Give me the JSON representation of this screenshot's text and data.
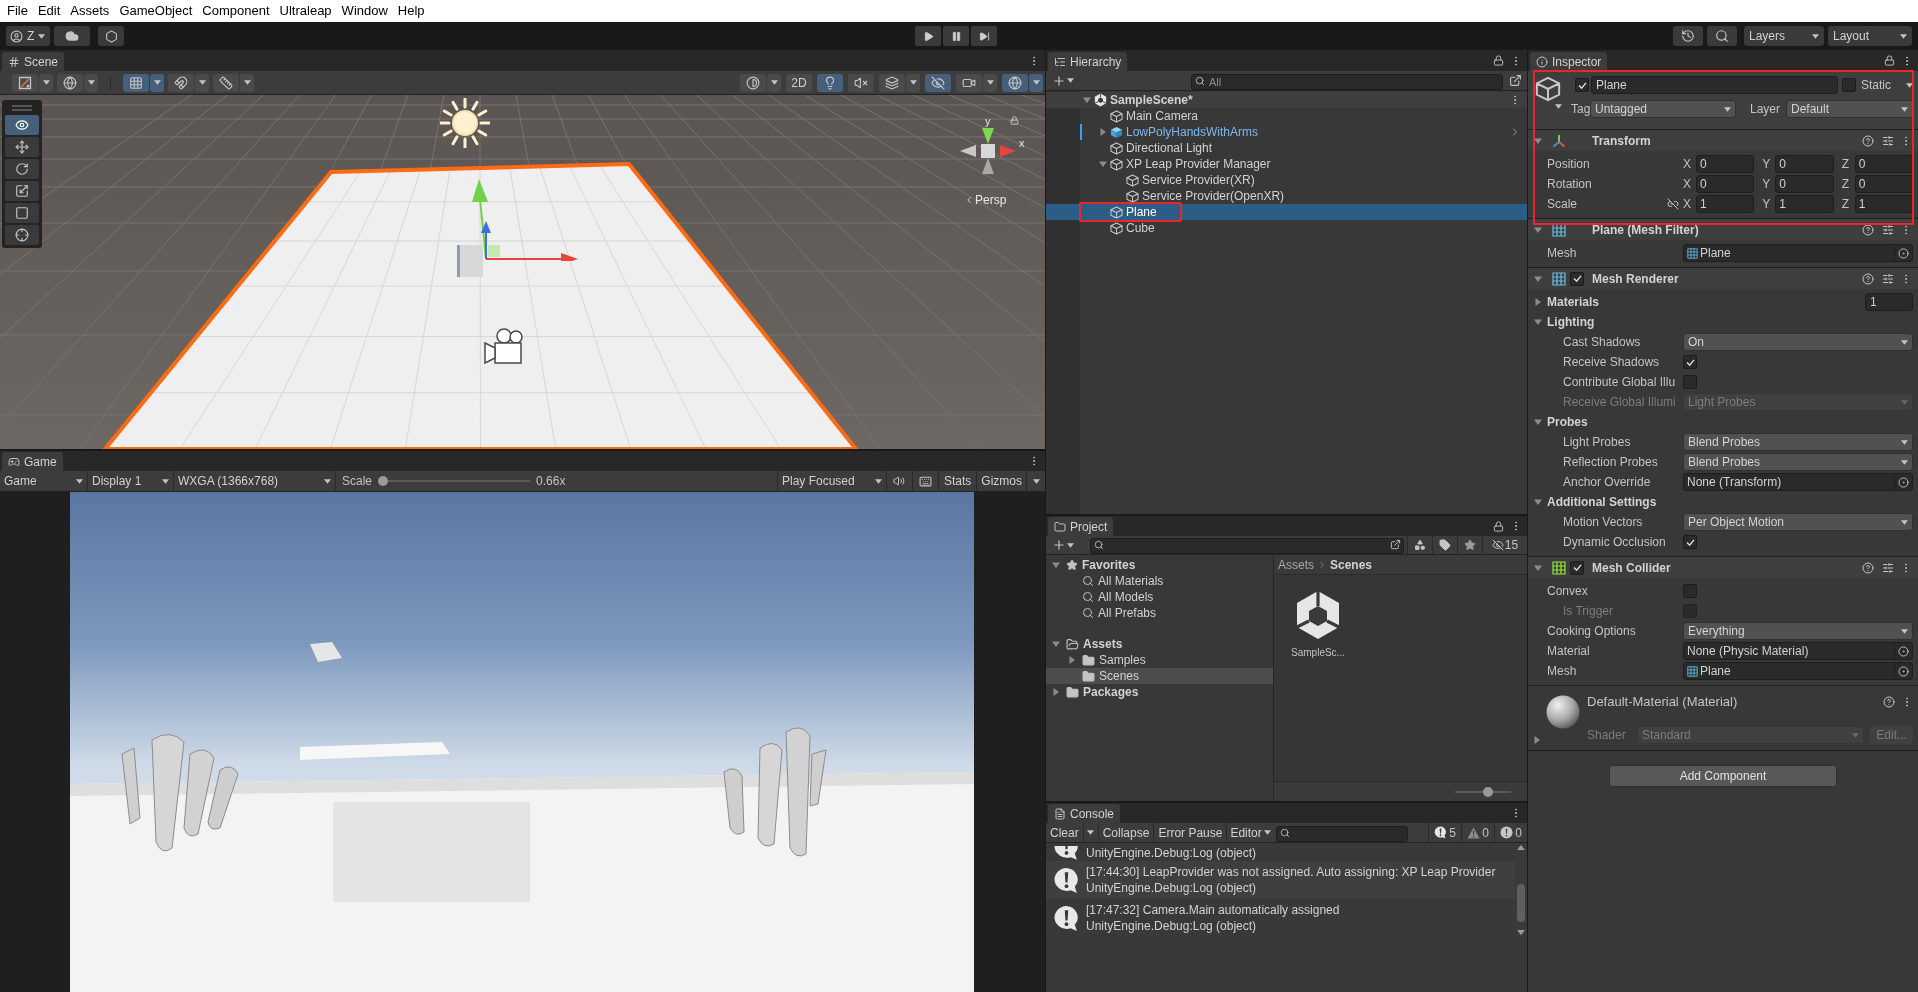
{
  "menu_bar": {
    "items": [
      "File",
      "Edit",
      "Assets",
      "GameObject",
      "Component",
      "Ultraleap",
      "Window",
      "Help"
    ]
  },
  "toolbar": {
    "account": "Z",
    "play_controls": [
      {
        "kind": "play"
      },
      {
        "kind": "pause"
      },
      {
        "kind": "step"
      }
    ],
    "layers": "Layers",
    "layout": "Layout"
  },
  "scene": {
    "tab": "Scene",
    "toolbar_left": [
      {
        "kind": "draw-mode",
        "on": false,
        "dropdown": true
      },
      {
        "kind": "globe",
        "on": false,
        "dropdown": true
      },
      {
        "kind": "grid-snap",
        "on": true,
        "dropdown": true
      },
      {
        "kind": "snap",
        "on": false,
        "dropdown": true
      },
      {
        "kind": "ruler",
        "on": false,
        "dropdown": true
      }
    ],
    "toolbar_right": [
      {
        "kind": "shading",
        "on": false,
        "dropdown": true
      },
      {
        "kind": "text",
        "label": "2D",
        "on": false,
        "dropdown": false
      },
      {
        "kind": "light",
        "on": true,
        "dropdown": false
      },
      {
        "kind": "audio",
        "on": false,
        "dropdown": false
      },
      {
        "kind": "effects",
        "on": false,
        "dropdown": true
      },
      {
        "kind": "visibility",
        "on": true,
        "dropdown": false
      },
      {
        "kind": "camera",
        "on": false,
        "dropdown": true
      },
      {
        "kind": "gizmos",
        "on": true,
        "dropdown": true
      }
    ],
    "tools": [
      {
        "kind": "view",
        "selected": true
      },
      {
        "kind": "move",
        "selected": false
      },
      {
        "kind": "rotate",
        "selected": false
      },
      {
        "kind": "scale",
        "selected": false
      },
      {
        "kind": "rect",
        "selected": false
      },
      {
        "kind": "transform",
        "selected": false
      }
    ],
    "axis_labels": [
      "y",
      "x"
    ],
    "projection": "Persp"
  },
  "game": {
    "tab": "Game",
    "mode": "Game",
    "display": "Display 1",
    "resolution": "WXGA (1366x768)",
    "scale_label": "Scale",
    "scale": {
      "level": 0,
      "reading": "0.66x"
    },
    "play_mode": "Play Focused",
    "stats": "Stats",
    "gizmos": "Gizmos"
  },
  "hierarchy": {
    "tab": "Hierarchy",
    "search": {
      "placeholder": "All"
    },
    "tree": [
      {
        "kind": "scene",
        "label": "SampleScene*",
        "expanded": true,
        "selected": false,
        "annotated": false,
        "children": [
          {
            "kind": "object",
            "label": "Main Camera",
            "selected": false,
            "annotated": false
          },
          {
            "kind": "prefab",
            "label": "LowPolyHandsWithArms",
            "expanded": false,
            "selected": false,
            "annotated": false
          },
          {
            "kind": "object",
            "label": "Directional Light",
            "selected": false,
            "annotated": false
          },
          {
            "kind": "object",
            "label": "XP Leap Provider Manager",
            "expanded": true,
            "selected": false,
            "annotated": false,
            "children": [
              {
                "kind": "object",
                "label": "Service Provider(XR)",
                "selected": false,
                "annotated": false
              },
              {
                "kind": "object",
                "label": "Service Provider(OpenXR)",
                "selected": false,
                "annotated": false
              }
            ]
          },
          {
            "kind": "object",
            "label": "Plane",
            "selected": true,
            "annotated": true
          },
          {
            "kind": "object",
            "label": "Cube",
            "selected": false,
            "annotated": false
          }
        ]
      }
    ]
  },
  "project": {
    "tab": "Project",
    "hidden_count": "15",
    "tree": [
      {
        "kind": "favorites",
        "label": "Favorites",
        "expanded": true,
        "selected": false,
        "children": [
          {
            "kind": "search",
            "label": "All Materials",
            "selected": false
          },
          {
            "kind": "search",
            "label": "All Models",
            "selected": false
          },
          {
            "kind": "search",
            "label": "All Prefabs",
            "selected": false
          }
        ]
      },
      {
        "kind": "root-folder",
        "label": "Assets",
        "expanded": true,
        "selected": false,
        "children": [
          {
            "kind": "folder",
            "label": "Samples",
            "expanded": false,
            "selected": false
          },
          {
            "kind": "folder",
            "label": "Scenes",
            "selected": true
          }
        ]
      },
      {
        "kind": "root-folder",
        "label": "Packages",
        "expanded": false,
        "selected": false
      }
    ],
    "breadcrumb": [
      "Assets",
      "Scenes"
    ],
    "assets": [
      {
        "kind": "scene",
        "label": "SampleSc..."
      }
    ],
    "zoom": {
      "level": 0.6
    }
  },
  "console": {
    "tab": "Console",
    "clear": "Clear",
    "collapse": "Collapse",
    "error_pause": "Error Pause",
    "editor": "Editor",
    "counts": [
      {
        "kind": "info",
        "count": "5"
      },
      {
        "kind": "warning",
        "count": "0"
      },
      {
        "kind": "error",
        "count": "0"
      }
    ],
    "entries": [
      {
        "kind": "log",
        "clipped": true,
        "lines": [
          "UnityEngine.Debug:Log (object)"
        ]
      },
      {
        "kind": "log",
        "clipped": false,
        "lines": [
          "[17:44:30] LeapProvider was not assigned. Auto assigning: XP Leap Provider",
          "UnityEngine.Debug:Log (object)"
        ]
      },
      {
        "kind": "log",
        "clipped": false,
        "lines": [
          "[17:47:32] Camera.Main automatically assigned",
          "UnityEngine.Debug:Log (object)"
        ]
      }
    ]
  },
  "inspector": {
    "tab": "Inspector",
    "annotated": true,
    "header": {
      "active": true,
      "name": "Plane",
      "static": false,
      "static_label": "Static",
      "tag_label": "Tag",
      "tag": "Untagged",
      "layer_label": "Layer",
      "layer": "Default"
    },
    "components": [
      {
        "kind": "transform",
        "title": "Transform",
        "expanded": true,
        "rows": [
          {
            "kind": "vector",
            "label": "Position",
            "values": [
              {
                "axis": "X",
                "value": "0"
              },
              {
                "axis": "Y",
                "value": "0"
              },
              {
                "axis": "Z",
                "value": "0"
              }
            ]
          },
          {
            "kind": "vector",
            "label": "Rotation",
            "values": [
              {
                "axis": "X",
                "value": "0"
              },
              {
                "axis": "Y",
                "value": "0"
              },
              {
                "axis": "Z",
                "value": "0"
              }
            ]
          },
          {
            "kind": "scale",
            "label": "Scale",
            "locked": false,
            "values": [
              {
                "axis": "X",
                "value": "1"
              },
              {
                "axis": "Y",
                "value": "1"
              },
              {
                "axis": "Z",
                "value": "1"
              }
            ]
          }
        ]
      },
      {
        "kind": "mesh-filter",
        "title": "Plane (Mesh Filter)",
        "expanded": true,
        "fields": [
          {
            "kind": "object",
            "label": "Mesh",
            "value": "Plane",
            "asset_icon": true,
            "disabled": false
          }
        ]
      },
      {
        "kind": "mesh-renderer",
        "title": "Mesh Renderer",
        "enabled": true,
        "expanded": true,
        "fields": [
          {
            "kind": "array",
            "label": "Materials",
            "expanded": false,
            "value": "1",
            "disabled": false
          },
          {
            "kind": "group",
            "label": "Lighting",
            "expanded": true,
            "disabled": false,
            "children": [
              {
                "kind": "dropdown",
                "label": "Cast Shadows",
                "value": "On",
                "disabled": false
              },
              {
                "kind": "checkbox",
                "label": "Receive Shadows",
                "checked": true,
                "disabled": false
              },
              {
                "kind": "checkbox",
                "label": "Contribute Global Illu",
                "checked": false,
                "disabled": false
              },
              {
                "kind": "dropdown",
                "label": "Receive Global Illumi",
                "value": "Light Probes",
                "disabled": true
              }
            ]
          },
          {
            "kind": "group",
            "label": "Probes",
            "expanded": true,
            "disabled": false,
            "children": [
              {
                "kind": "dropdown",
                "label": "Light Probes",
                "value": "Blend Probes",
                "disabled": false
              },
              {
                "kind": "dropdown",
                "label": "Reflection Probes",
                "value": "Blend Probes",
                "disabled": false
              },
              {
                "kind": "object",
                "label": "Anchor Override",
                "value": "None (Transform)",
                "asset_icon": false,
                "disabled": false
              }
            ]
          },
          {
            "kind": "group",
            "label": "Additional Settings",
            "expanded": true,
            "disabled": false,
            "children": [
              {
                "kind": "dropdown",
                "label": "Motion Vectors",
                "value": "Per Object Motion",
                "disabled": false
              },
              {
                "kind": "checkbox",
                "label": "Dynamic Occlusion",
                "checked": true,
                "disabled": false
              }
            ]
          }
        ]
      },
      {
        "kind": "mesh-collider",
        "title": "Mesh Collider",
        "enabled": true,
        "expanded": true,
        "fields": [
          {
            "kind": "checkbox",
            "label": "Convex",
            "checked": false,
            "disabled": false,
            "children": [
              {
                "kind": "checkbox",
                "label": "Is Trigger",
                "checked": false,
                "disabled": true
              }
            ]
          },
          {
            "kind": "dropdown",
            "label": "Cooking Options",
            "value": "Everything",
            "disabled": false
          },
          {
            "kind": "object",
            "label": "Material",
            "value": "None (Physic Material)",
            "asset_icon": false,
            "disabled": false
          },
          {
            "kind": "object",
            "label": "Mesh",
            "value": "Plane",
            "asset_icon": true,
            "disabled": false
          }
        ]
      },
      {
        "kind": "material",
        "title": "Default-Material (Material)",
        "expanded": false,
        "disabled": true,
        "shader_label": "Shader",
        "shader": "Standard",
        "edit": "Edit..."
      }
    ],
    "add_component": "Add Component"
  }
}
